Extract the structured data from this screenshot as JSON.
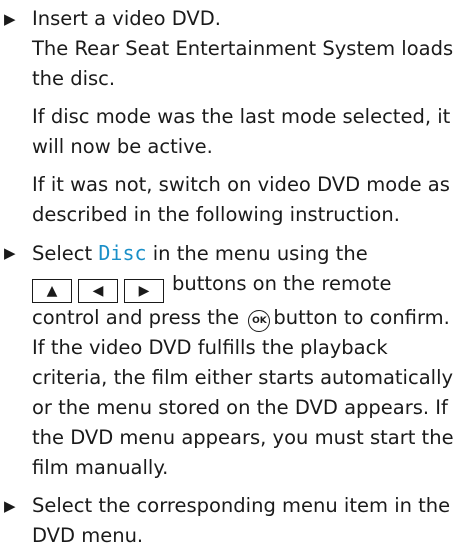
{
  "steps": [
    {
      "marker": "▶",
      "line1": "Insert a video DVD.",
      "line2": "The Rear Seat Entertainment System loads",
      "line3": "the disc.",
      "line4": "If disc mode was the last mode selected, it",
      "line5": "will now be active.",
      "line6": "If it was not, switch on video DVD mode as",
      "line7": "described in the following instruction."
    },
    {
      "marker": "▶",
      "pre": "Select ",
      "menu_item": "Disc",
      "post": " in the menu using the",
      "keys": {
        "up": "▲",
        "left": "◀",
        "right": "▶"
      },
      "after_keys": "buttons on the remote",
      "line_confirm_a": "control and press the",
      "ok_label": "OK",
      "line_confirm_b": "button to confirm.",
      "l4": "If the video DVD fulfills the playback",
      "l5": "criteria, the film either starts automatically",
      "l6": "or the menu stored on the DVD appears. If",
      "l7": "the DVD menu appears, you must start the",
      "l8": "film manually."
    },
    {
      "marker": "▶",
      "line1": "Select the corresponding menu item in the",
      "line2": "DVD menu."
    }
  ],
  "colors": {
    "text": "#1a1a1a",
    "menu_item": "#1a8fc8"
  }
}
